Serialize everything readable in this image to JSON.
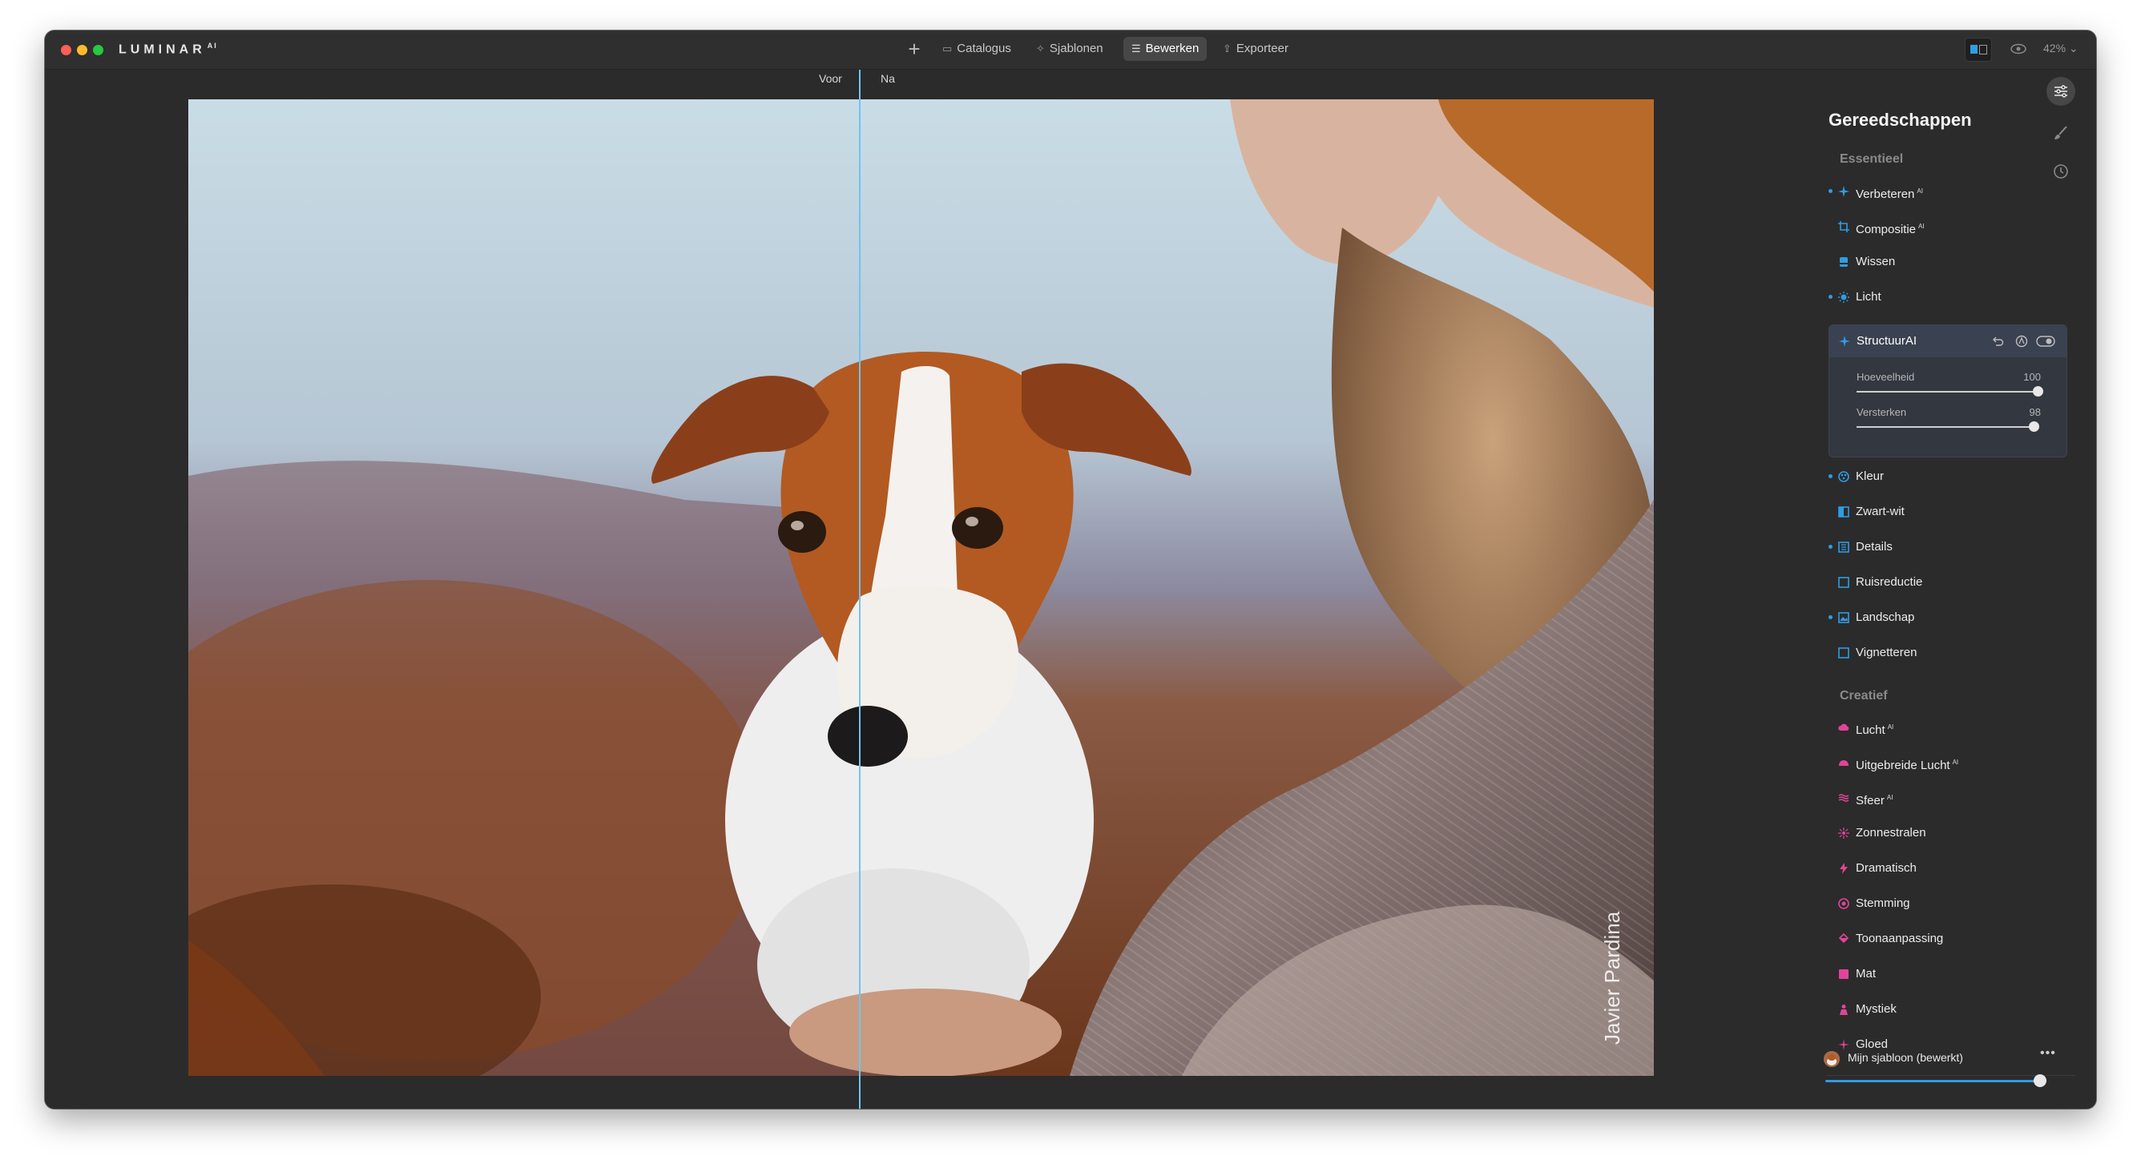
{
  "app": {
    "brand": "LUMINAR",
    "brand_sup": "AI"
  },
  "toolbar": {
    "tabs": [
      {
        "label": "Catalogus",
        "icon": "folder-icon",
        "active": false
      },
      {
        "label": "Sjablonen",
        "icon": "sparkle-icon",
        "active": false
      },
      {
        "label": "Bewerken",
        "icon": "sliders-icon",
        "active": true
      },
      {
        "label": "Exporteer",
        "icon": "share-icon",
        "active": false
      }
    ],
    "zoom": "42%"
  },
  "canvas": {
    "before_label": "Voor",
    "after_label": "Na",
    "watermark": "Javier Pardina"
  },
  "panel": {
    "title": "Gereedschappen",
    "essential_label": "Essentieel",
    "essential_tools": [
      {
        "name": "Verbeteren",
        "ai": "AI",
        "icon": "sparkle-icon",
        "color": "#2f9de2",
        "dot": true
      },
      {
        "name": "Compositie",
        "ai": "AI",
        "icon": "crop-icon",
        "color": "#2f9de2",
        "dot": false
      },
      {
        "name": "Wissen",
        "ai": "",
        "icon": "eraser-icon",
        "color": "#2f9de2",
        "dot": false
      },
      {
        "name": "Licht",
        "ai": "",
        "icon": "sun-icon",
        "color": "#2f9de2",
        "dot": true
      }
    ],
    "structure": {
      "name": "Structuur",
      "ai": "AI",
      "sliders": [
        {
          "label": "Hoeveelheid",
          "value": "100",
          "fraction": 1.0
        },
        {
          "label": "Versterken",
          "value": "98",
          "fraction": 0.98
        }
      ]
    },
    "essential_tools_2": [
      {
        "name": "Kleur",
        "ai": "",
        "icon": "palette-icon",
        "color": "#2f9de2",
        "dot": true
      },
      {
        "name": "Zwart-wit",
        "ai": "",
        "icon": "bw-icon",
        "color": "#2f9de2",
        "dot": false
      },
      {
        "name": "Details",
        "ai": "",
        "icon": "details-icon",
        "color": "#2f9de2",
        "dot": true
      },
      {
        "name": "Ruisreductie",
        "ai": "",
        "icon": "noise-icon",
        "color": "#2f9de2",
        "dot": false
      },
      {
        "name": "Landschap",
        "ai": "",
        "icon": "landscape-icon",
        "color": "#2f9de2",
        "dot": true
      },
      {
        "name": "Vignetteren",
        "ai": "",
        "icon": "vignette-icon",
        "color": "#2f9de2",
        "dot": false
      }
    ],
    "creative_label": "Creatief",
    "creative_tools": [
      {
        "name": "Lucht",
        "ai": "AI",
        "icon": "cloud-icon",
        "color": "#e0449a"
      },
      {
        "name": "Uitgebreide Lucht",
        "ai": "AI",
        "icon": "cloud-plus-icon",
        "color": "#e0449a"
      },
      {
        "name": "Sfeer",
        "ai": "AI",
        "icon": "waves-icon",
        "color": "#e0449a"
      },
      {
        "name": "Zonnestralen",
        "ai": "",
        "icon": "sunrays-icon",
        "color": "#e0449a"
      },
      {
        "name": "Dramatisch",
        "ai": "",
        "icon": "bolt-icon",
        "color": "#e0449a"
      },
      {
        "name": "Stemming",
        "ai": "",
        "icon": "mood-icon",
        "color": "#e0449a"
      },
      {
        "name": "Toonaanpassing",
        "ai": "",
        "icon": "bucket-icon",
        "color": "#e0449a"
      },
      {
        "name": "Mat",
        "ai": "",
        "icon": "mat-icon",
        "color": "#e0449a"
      },
      {
        "name": "Mystiek",
        "ai": "",
        "icon": "mystic-icon",
        "color": "#e0449a"
      },
      {
        "name": "Gloed",
        "ai": "",
        "icon": "glow-icon",
        "color": "#e0449a"
      }
    ],
    "template": {
      "name": "Mijn sjabloon (bewerkt)",
      "amount": 1.0
    }
  },
  "colors": {
    "accent": "#2f9de2",
    "creative": "#e0449a"
  }
}
